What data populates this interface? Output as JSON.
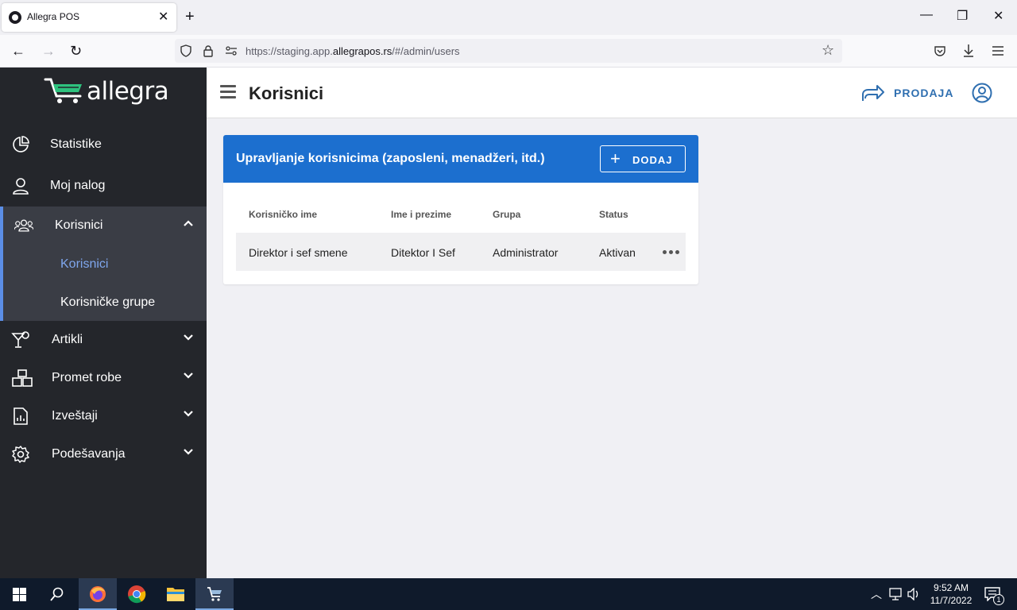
{
  "browser": {
    "tab_title": "Allegra POS",
    "url_prefix": "https://staging.app.",
    "url_domain": "allegrapos.rs",
    "url_suffix": "/#/admin/users"
  },
  "sidebar": {
    "logo_text": "allegra",
    "items": [
      {
        "label": "Statistike",
        "icon": "pie-chart-icon"
      },
      {
        "label": "Moj nalog",
        "icon": "user-icon"
      },
      {
        "label": "Korisnici",
        "icon": "users-icon",
        "expanded": true
      },
      {
        "label": "Artikli",
        "icon": "cocktail-icon"
      },
      {
        "label": "Promet robe",
        "icon": "boxes-icon"
      },
      {
        "label": "Izveštaji",
        "icon": "report-icon"
      },
      {
        "label": "Podešavanja",
        "icon": "gear-icon"
      }
    ],
    "subitems": [
      {
        "label": "Korisnici",
        "active": true
      },
      {
        "label": "Korisničke grupe",
        "active": false
      }
    ],
    "accent_color": "#5b8ee6"
  },
  "header": {
    "title": "Korisnici",
    "prodaja_label": "PRODAJA"
  },
  "card": {
    "title": "Upravljanje korisnicima (zaposleni, menadžeri, itd.)",
    "add_label": "DODAJ",
    "header_color": "#1c6fcf",
    "columns": [
      "Korisničko ime",
      "Ime i prezime",
      "Grupa",
      "Status"
    ],
    "rows": [
      [
        "Direktor i sef smene",
        "Ditektor I Sef",
        "Administrator",
        "Aktivan"
      ]
    ]
  },
  "taskbar": {
    "time": "9:52 AM",
    "date": "11/7/2022",
    "notification_count": "1"
  }
}
